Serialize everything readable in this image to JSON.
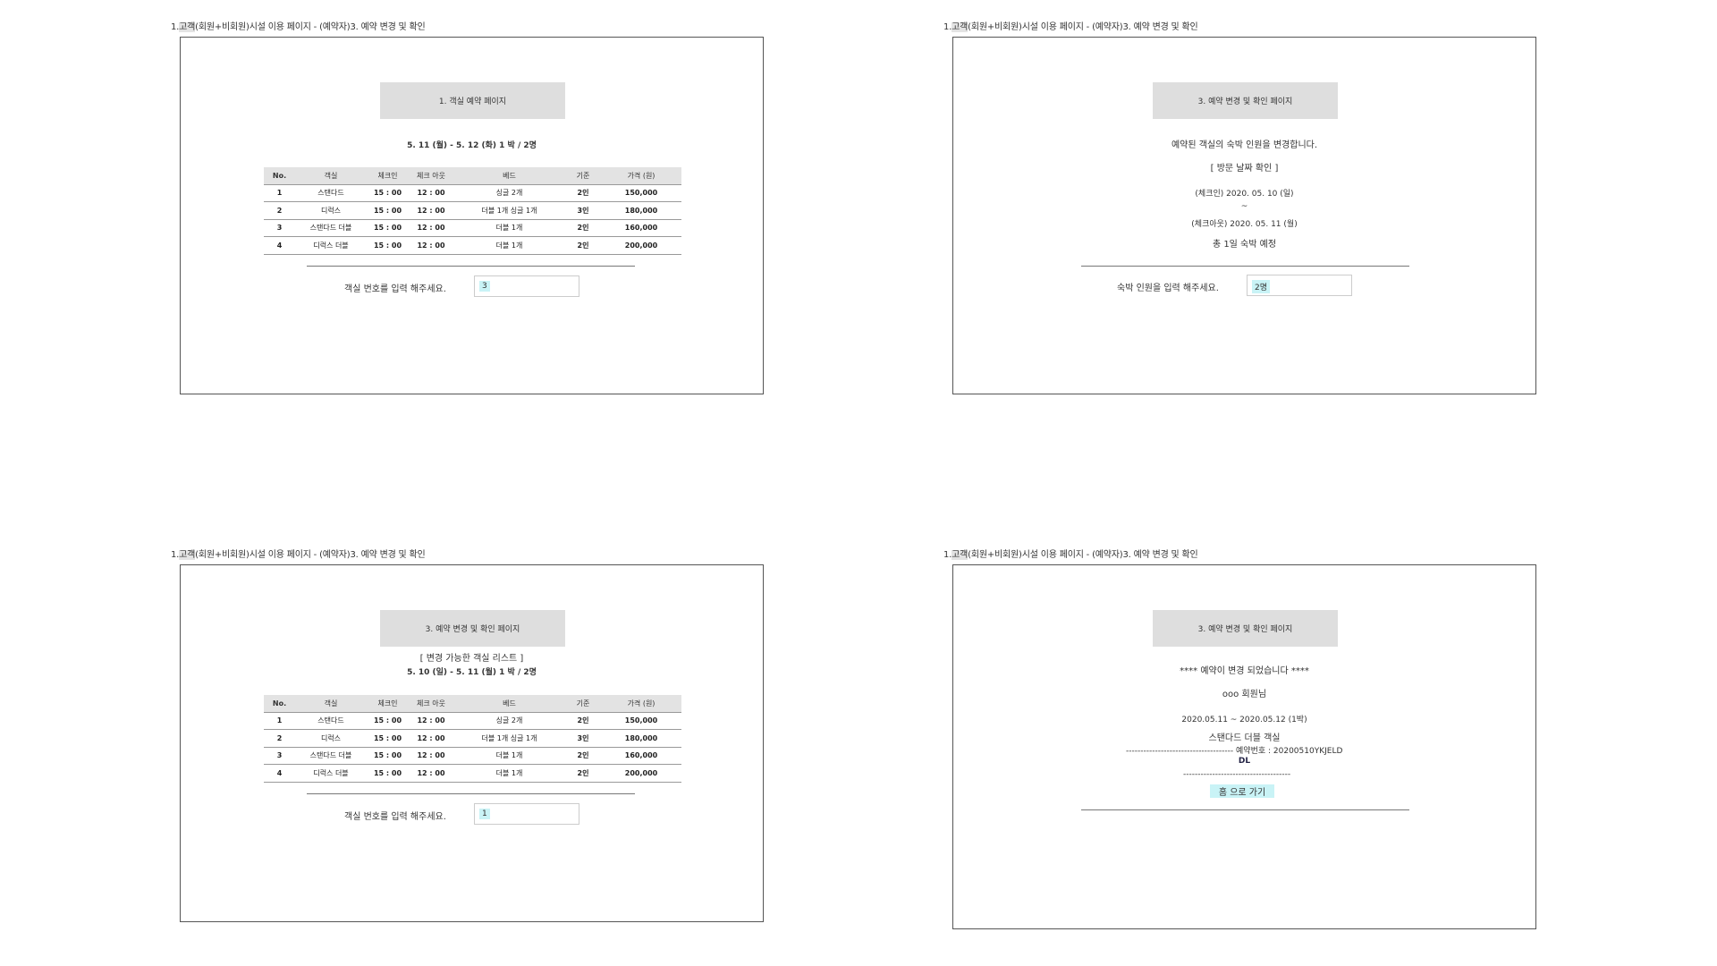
{
  "captions": {
    "num": "1.",
    "customer": "고객",
    "member_type": "(회원+비회원)",
    "site_page": "시설 이용 페이지 - (예약자)",
    "section": "3. 예약 변경 및 확인"
  },
  "panel1": {
    "banner": "1. 객실 예약 페이지",
    "stay": "5. 11 (월) - 5. 12 (화) 1 박 / 2명",
    "prompt": "객실 번호를 입력 해주세요.",
    "input_value": "3"
  },
  "panel2": {
    "banner": "3. 예약 변경 및 확인 페이지",
    "message": "예약된 객실의 숙박 인원을 변경합니다.",
    "date_header": "[ 방문 날짜 확인 ]",
    "checkin": "(체크인) 2020. 05. 10 (일)",
    "tilde": "~",
    "checkout": "(체크아웃) 2020. 05. 11 (월)",
    "total": "총 1일 숙박 예정",
    "prompt": "숙박 인원을 입력 해주세요.",
    "input_value": "2명"
  },
  "panel3": {
    "banner": "3. 예약 변경 및 확인 페이지",
    "list_header": "[ 변경 가능한 객실 리스트 ]",
    "stay": "5. 10 (일) - 5. 11 (월) 1 박 / 2명",
    "prompt": "객실 번호를 입력 해주세요.",
    "input_value": "1"
  },
  "panel4": {
    "banner": "3. 예약 변경 및 확인 페이지",
    "done": "**** 예약이 변경 되었습니다 ****",
    "member": "ooo 회원님",
    "period": "2020.05.11 ~ 2020.05.12  (1박)",
    "room": "스탠다드 더블 객실",
    "reservation_line": "------------------------------------- 예약번호 : 20200510YKJELD",
    "reservation_tail": "DL",
    "dash_line": "-------------------------------------",
    "home_button": "홈 으로 가기"
  },
  "room_table": {
    "headers": [
      "No.",
      "객실",
      "체크인",
      "체크 아웃",
      "베드",
      "기준",
      "가격 (원)"
    ],
    "rows": [
      [
        "1",
        "스탠다드",
        "15 : 00",
        "12 : 00",
        "싱글 2개",
        "2인",
        "150,000"
      ],
      [
        "2",
        "디럭스",
        "15 : 00",
        "12 : 00",
        "더블 1개 싱글 1개",
        "3인",
        "180,000"
      ],
      [
        "3",
        "스탠다드 더블",
        "15 : 00",
        "12 : 00",
        "더블 1개",
        "2인",
        "160,000"
      ],
      [
        "4",
        "디럭스 더블",
        "15 : 00",
        "12 : 00",
        "더블 1개",
        "2인",
        "200,000"
      ]
    ]
  },
  "colors": {
    "banner_bg": "#dedede",
    "input_highlight": "#c9f3f6",
    "table_header_bg": "#e3e3e3"
  }
}
